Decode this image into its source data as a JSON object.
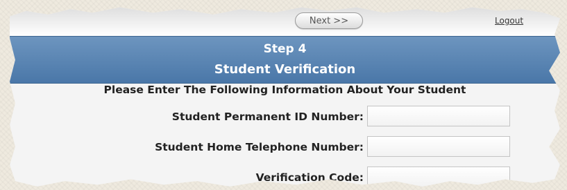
{
  "nav": {
    "next_label": "Next >>",
    "logout_label": "Logout"
  },
  "header": {
    "step": "Step 4",
    "title": "Student Verification"
  },
  "form": {
    "instructions": "Please Enter The Following Information About Your Student",
    "fields": [
      {
        "label": "Student Permanent ID Number:",
        "value": "",
        "placeholder": ""
      },
      {
        "label": "Student Home Telephone Number:",
        "value": "",
        "placeholder": ""
      },
      {
        "label": "Verification Code:",
        "value": "",
        "placeholder": ""
      }
    ]
  },
  "colors": {
    "banner": "#4f7cad",
    "background": "#efeadf"
  }
}
